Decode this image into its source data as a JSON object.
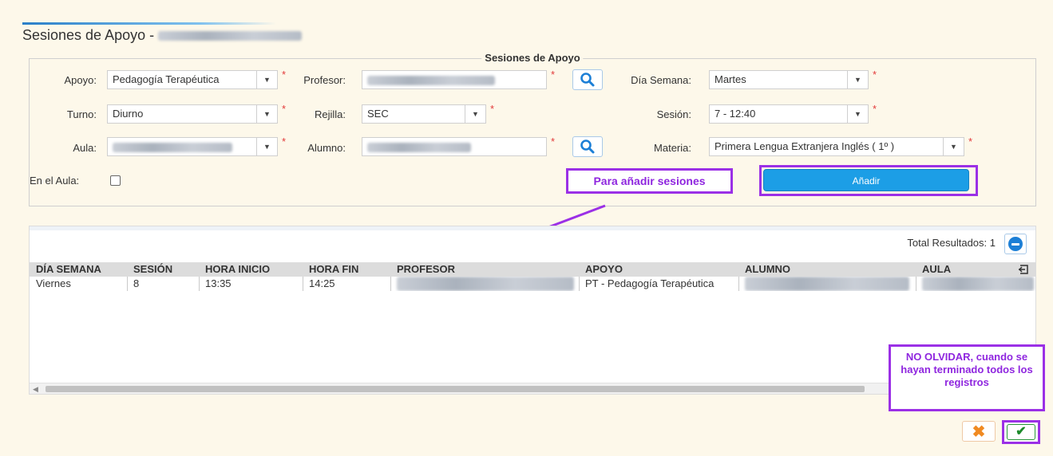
{
  "page": {
    "title": "Sesiones de Apoyo - "
  },
  "form": {
    "legend": "Sesiones de Apoyo",
    "apoyo": {
      "label": "Apoyo:",
      "value": "Pedagogía Terapéutica"
    },
    "profesor": {
      "label": "Profesor:"
    },
    "dia_semana": {
      "label": "Día Semana:",
      "value": "Martes"
    },
    "turno": {
      "label": "Turno:",
      "value": "Diurno"
    },
    "rejilla": {
      "label": "Rejilla:",
      "value": "SEC"
    },
    "sesion": {
      "label": "Sesión:",
      "value": "7 - 12:40"
    },
    "aula": {
      "label": "Aula:"
    },
    "alumno": {
      "label": "Alumno:"
    },
    "materia": {
      "label": "Materia:",
      "value": "Primera Lengua Extranjera Inglés ( 1º )"
    },
    "en_el_aula": {
      "label": "En el Aula:",
      "checked": false
    },
    "required_mark": "*",
    "add_button": "Añadir",
    "callout_add": "Para añadir sesiones"
  },
  "results": {
    "total_label": "Total Resultados: 1",
    "columns": [
      "DÍA SEMANA",
      "SESIÓN",
      "HORA INICIO",
      "HORA FIN",
      "PROFESOR",
      "APOYO",
      "ALUMNO",
      "AULA"
    ],
    "rows": [
      {
        "dia": "Viernes",
        "sesion": "8",
        "hora_inicio": "13:35",
        "hora_fin": "14:25",
        "apoyo": "PT - Pedagogía Terapéutica"
      }
    ]
  },
  "callout_finish": "NO OLVIDAR, cuando se hayan terminado todos los registros",
  "colors": {
    "accent": "#9b30e6",
    "primary": "#1c9ee6",
    "background": "#fdf8ea",
    "required": "#e23a3a"
  },
  "icons": [
    "search-icon",
    "chevron-down-icon",
    "minus-circle-icon",
    "export-icon",
    "close-icon",
    "check-icon"
  ]
}
